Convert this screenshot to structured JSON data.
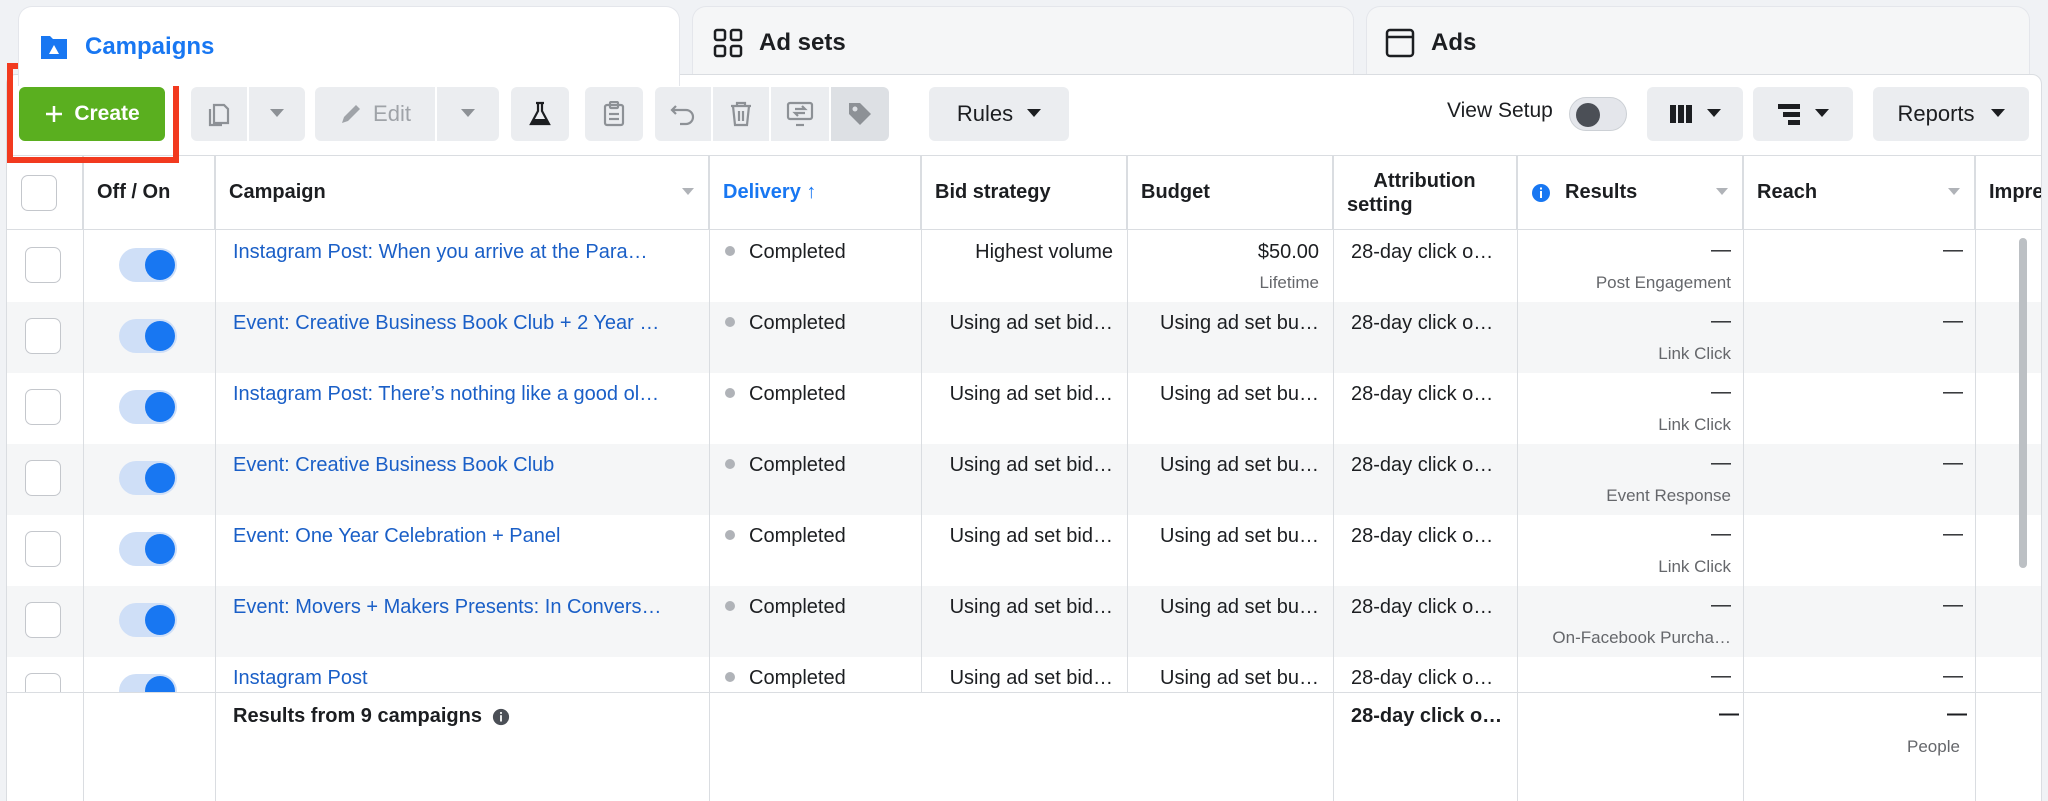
{
  "tabs": [
    {
      "label": "Campaigns",
      "icon": "folder-icon"
    },
    {
      "label": "Ad sets",
      "icon": "grid-icon"
    },
    {
      "label": "Ads",
      "icon": "ad-window-icon"
    }
  ],
  "toolbar": {
    "create_label": "Create",
    "edit_label": "Edit",
    "rules_label": "Rules",
    "view_setup_label": "View Setup",
    "view_setup_on": false,
    "reports_label": "Reports",
    "colors": {
      "create": "#5aaf1f",
      "highlight": "#f23a1f",
      "link": "#1a5fc7"
    }
  },
  "table": {
    "headers": {
      "off_on": "Off / On",
      "campaign": "Campaign",
      "delivery": "Delivery ↑",
      "bid_strategy": "Bid strategy",
      "budget": "Budget",
      "attribution_line1": "Attribution",
      "attribution_line2": "setting",
      "results": "Results",
      "reach": "Reach",
      "impressions": "Impre"
    },
    "rows": [
      {
        "campaign": "Instagram Post: When you arrive at the Para…",
        "delivery": "Completed",
        "bid": "Highest volume",
        "budget": "$50.00",
        "budget_sub": "Lifetime",
        "attribution": "28-day click o…",
        "results": "—",
        "results_sub": "Post Engagement",
        "reach": "—"
      },
      {
        "campaign": "Event: Creative Business Book Club + 2 Year …",
        "delivery": "Completed",
        "bid": "Using ad set bid…",
        "budget": "Using ad set bu…",
        "budget_sub": "",
        "attribution": "28-day click o…",
        "results": "—",
        "results_sub": "Link Click",
        "reach": "—"
      },
      {
        "campaign": "Instagram Post: There’s nothing like a good ol…",
        "delivery": "Completed",
        "bid": "Using ad set bid…",
        "budget": "Using ad set bu…",
        "budget_sub": "",
        "attribution": "28-day click o…",
        "results": "—",
        "results_sub": "Link Click",
        "reach": "—"
      },
      {
        "campaign": "Event: Creative Business Book Club",
        "delivery": "Completed",
        "bid": "Using ad set bid…",
        "budget": "Using ad set bu…",
        "budget_sub": "",
        "attribution": "28-day click o…",
        "results": "—",
        "results_sub": "Event Response",
        "reach": "—"
      },
      {
        "campaign": "Event: One Year Celebration + Panel",
        "delivery": "Completed",
        "bid": "Using ad set bid…",
        "budget": "Using ad set bu…",
        "budget_sub": "",
        "attribution": "28-day click o…",
        "results": "—",
        "results_sub": "Link Click",
        "reach": "—"
      },
      {
        "campaign": "Event: Movers + Makers Presents: In Convers…",
        "delivery": "Completed",
        "bid": "Using ad set bid…",
        "budget": "Using ad set bu…",
        "budget_sub": "",
        "attribution": "28-day click o…",
        "results": "—",
        "results_sub": "On-Facebook Purcha…",
        "reach": "—"
      },
      {
        "campaign": "Instagram Post",
        "delivery": "Completed",
        "bid": "Using ad set bid…",
        "budget": "Using ad set bu…",
        "budget_sub": "",
        "attribution": "28-day click o…",
        "results": "—",
        "results_sub": "",
        "reach": "—"
      }
    ],
    "footer": {
      "label": "Results from 9 campaigns",
      "attribution": "28-day click o…",
      "results": "—",
      "reach": "—",
      "reach_sub": "People"
    }
  }
}
